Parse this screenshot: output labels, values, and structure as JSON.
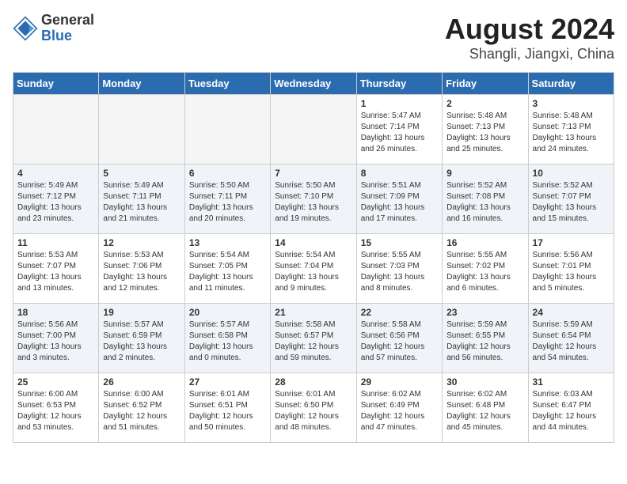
{
  "header": {
    "logo_general": "General",
    "logo_blue": "Blue",
    "month": "August 2024",
    "location": "Shangli, Jiangxi, China"
  },
  "days_of_week": [
    "Sunday",
    "Monday",
    "Tuesday",
    "Wednesday",
    "Thursday",
    "Friday",
    "Saturday"
  ],
  "weeks": [
    [
      {
        "day": "",
        "info": ""
      },
      {
        "day": "",
        "info": ""
      },
      {
        "day": "",
        "info": ""
      },
      {
        "day": "",
        "info": ""
      },
      {
        "day": "1",
        "info": "Sunrise: 5:47 AM\nSunset: 7:14 PM\nDaylight: 13 hours\nand 26 minutes."
      },
      {
        "day": "2",
        "info": "Sunrise: 5:48 AM\nSunset: 7:13 PM\nDaylight: 13 hours\nand 25 minutes."
      },
      {
        "day": "3",
        "info": "Sunrise: 5:48 AM\nSunset: 7:13 PM\nDaylight: 13 hours\nand 24 minutes."
      }
    ],
    [
      {
        "day": "4",
        "info": "Sunrise: 5:49 AM\nSunset: 7:12 PM\nDaylight: 13 hours\nand 23 minutes."
      },
      {
        "day": "5",
        "info": "Sunrise: 5:49 AM\nSunset: 7:11 PM\nDaylight: 13 hours\nand 21 minutes."
      },
      {
        "day": "6",
        "info": "Sunrise: 5:50 AM\nSunset: 7:11 PM\nDaylight: 13 hours\nand 20 minutes."
      },
      {
        "day": "7",
        "info": "Sunrise: 5:50 AM\nSunset: 7:10 PM\nDaylight: 13 hours\nand 19 minutes."
      },
      {
        "day": "8",
        "info": "Sunrise: 5:51 AM\nSunset: 7:09 PM\nDaylight: 13 hours\nand 17 minutes."
      },
      {
        "day": "9",
        "info": "Sunrise: 5:52 AM\nSunset: 7:08 PM\nDaylight: 13 hours\nand 16 minutes."
      },
      {
        "day": "10",
        "info": "Sunrise: 5:52 AM\nSunset: 7:07 PM\nDaylight: 13 hours\nand 15 minutes."
      }
    ],
    [
      {
        "day": "11",
        "info": "Sunrise: 5:53 AM\nSunset: 7:07 PM\nDaylight: 13 hours\nand 13 minutes."
      },
      {
        "day": "12",
        "info": "Sunrise: 5:53 AM\nSunset: 7:06 PM\nDaylight: 13 hours\nand 12 minutes."
      },
      {
        "day": "13",
        "info": "Sunrise: 5:54 AM\nSunset: 7:05 PM\nDaylight: 13 hours\nand 11 minutes."
      },
      {
        "day": "14",
        "info": "Sunrise: 5:54 AM\nSunset: 7:04 PM\nDaylight: 13 hours\nand 9 minutes."
      },
      {
        "day": "15",
        "info": "Sunrise: 5:55 AM\nSunset: 7:03 PM\nDaylight: 13 hours\nand 8 minutes."
      },
      {
        "day": "16",
        "info": "Sunrise: 5:55 AM\nSunset: 7:02 PM\nDaylight: 13 hours\nand 6 minutes."
      },
      {
        "day": "17",
        "info": "Sunrise: 5:56 AM\nSunset: 7:01 PM\nDaylight: 13 hours\nand 5 minutes."
      }
    ],
    [
      {
        "day": "18",
        "info": "Sunrise: 5:56 AM\nSunset: 7:00 PM\nDaylight: 13 hours\nand 3 minutes."
      },
      {
        "day": "19",
        "info": "Sunrise: 5:57 AM\nSunset: 6:59 PM\nDaylight: 13 hours\nand 2 minutes."
      },
      {
        "day": "20",
        "info": "Sunrise: 5:57 AM\nSunset: 6:58 PM\nDaylight: 13 hours\nand 0 minutes."
      },
      {
        "day": "21",
        "info": "Sunrise: 5:58 AM\nSunset: 6:57 PM\nDaylight: 12 hours\nand 59 minutes."
      },
      {
        "day": "22",
        "info": "Sunrise: 5:58 AM\nSunset: 6:56 PM\nDaylight: 12 hours\nand 57 minutes."
      },
      {
        "day": "23",
        "info": "Sunrise: 5:59 AM\nSunset: 6:55 PM\nDaylight: 12 hours\nand 56 minutes."
      },
      {
        "day": "24",
        "info": "Sunrise: 5:59 AM\nSunset: 6:54 PM\nDaylight: 12 hours\nand 54 minutes."
      }
    ],
    [
      {
        "day": "25",
        "info": "Sunrise: 6:00 AM\nSunset: 6:53 PM\nDaylight: 12 hours\nand 53 minutes."
      },
      {
        "day": "26",
        "info": "Sunrise: 6:00 AM\nSunset: 6:52 PM\nDaylight: 12 hours\nand 51 minutes."
      },
      {
        "day": "27",
        "info": "Sunrise: 6:01 AM\nSunset: 6:51 PM\nDaylight: 12 hours\nand 50 minutes."
      },
      {
        "day": "28",
        "info": "Sunrise: 6:01 AM\nSunset: 6:50 PM\nDaylight: 12 hours\nand 48 minutes."
      },
      {
        "day": "29",
        "info": "Sunrise: 6:02 AM\nSunset: 6:49 PM\nDaylight: 12 hours\nand 47 minutes."
      },
      {
        "day": "30",
        "info": "Sunrise: 6:02 AM\nSunset: 6:48 PM\nDaylight: 12 hours\nand 45 minutes."
      },
      {
        "day": "31",
        "info": "Sunrise: 6:03 AM\nSunset: 6:47 PM\nDaylight: 12 hours\nand 44 minutes."
      }
    ]
  ]
}
